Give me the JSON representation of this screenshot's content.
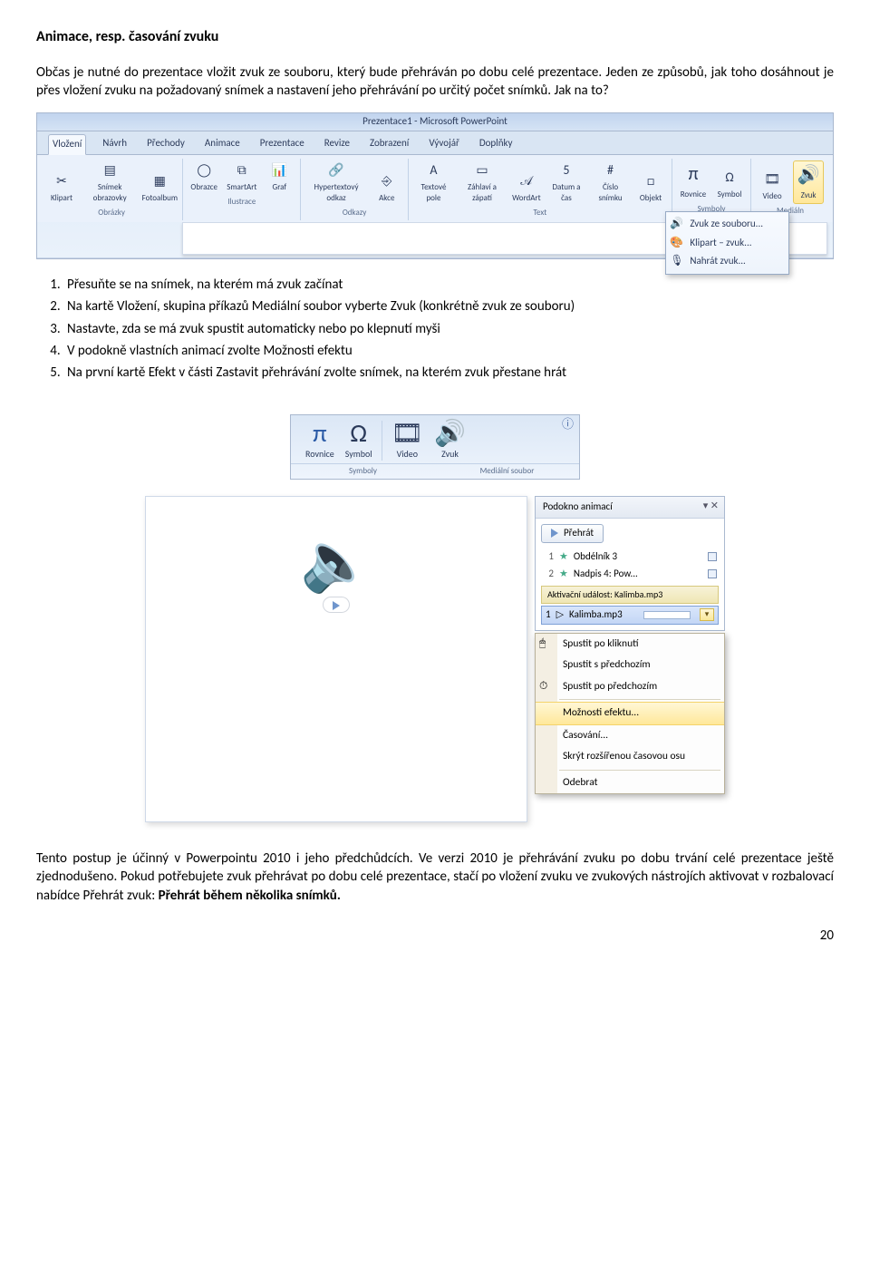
{
  "title": "Animace, resp. časování zvuku",
  "intro": "Občas je nutné do prezentace vložit zvuk ze souboru, který bude přehráván po dobu celé prezentace. Jeden ze způsobů, jak toho dosáhnout je přes vložení zvuku na požadovaný snímek a nastavení jeho přehrávání po určitý počet snímků. Jak na to?",
  "ribbon": {
    "title": "Prezentace1 - Microsoft PowerPoint",
    "tabs": [
      "Vložení",
      "Návrh",
      "Přechody",
      "Animace",
      "Prezentace",
      "Revize",
      "Zobrazení",
      "Vývojář",
      "Doplňky"
    ],
    "active_tab": "Vložení",
    "groups": {
      "obrazky": {
        "label": "Obrázky",
        "items": [
          {
            "icon": "✂",
            "label": "Klipart"
          },
          {
            "icon": "▤",
            "label": "Snímek obrazovky"
          },
          {
            "icon": "▦",
            "label": "Fotoalbum"
          }
        ]
      },
      "ilustrace": {
        "label": "Ilustrace",
        "items": [
          {
            "icon": "◯",
            "label": "Obrazce"
          },
          {
            "icon": "⧉",
            "label": "SmartArt"
          },
          {
            "icon": "📊",
            "label": "Graf"
          }
        ]
      },
      "odkazy": {
        "label": "Odkazy",
        "items": [
          {
            "icon": "🔗",
            "label": "Hypertextový odkaz"
          },
          {
            "icon": "⎆",
            "label": "Akce"
          }
        ]
      },
      "text": {
        "label": "Text",
        "items": [
          {
            "icon": "A",
            "label": "Textové pole"
          },
          {
            "icon": "▭",
            "label": "Záhlaví a zápatí"
          },
          {
            "icon": "𝒜",
            "label": "WordArt"
          },
          {
            "icon": "5",
            "label": "Datum a čas"
          },
          {
            "icon": "#",
            "label": "Číslo snímku"
          },
          {
            "icon": "□",
            "label": "Objekt"
          }
        ]
      },
      "symboly": {
        "label": "Symboly",
        "items": [
          {
            "icon": "π",
            "label": "Rovnice"
          },
          {
            "icon": "Ω",
            "label": "Symbol"
          }
        ]
      },
      "medialn": {
        "label": "Mediáln",
        "items": [
          {
            "icon": "🎞",
            "label": "Video"
          },
          {
            "icon": "🔊",
            "label": "Zvuk"
          }
        ]
      }
    },
    "menu": {
      "items": [
        {
          "icon": "🔊",
          "label": "Zvuk ze souboru...",
          "underline": "s"
        },
        {
          "icon": "🎨",
          "label": "Klipart – zvuk..."
        },
        {
          "icon": "🎙",
          "label": "Nahrát zvuk..."
        }
      ]
    }
  },
  "steps": [
    "Přesuňte se na snímek, na kterém má zvuk začínat",
    "Na kartě Vložení, skupina příkazů Mediální soubor vyberte Zvuk (konkrétně zvuk ze souboru)",
    "Nastavte, zda se má zvuk spustit automaticky nebo po klepnutí myši",
    "V podokně vlastních animací zvolte Možnosti efektu",
    "Na první kartě Efekt v části Zastavit přehrávání zvolte snímek, na kterém zvuk přestane hrát"
  ],
  "mini": {
    "help_icon": "ⓘ",
    "items": [
      {
        "icon": "π",
        "label": "Rovnice"
      },
      {
        "icon": "Ω",
        "label": "Symbol"
      },
      {
        "icon": "🎞",
        "label": "Video"
      },
      {
        "icon": "🔊",
        "label": "Zvuk"
      }
    ],
    "groups": [
      "Symboly",
      "Mediální soubor"
    ]
  },
  "pane": {
    "title": "Podokno animací",
    "play": "Přehrát",
    "items": [
      {
        "n": "1",
        "label": "Obdélník 3"
      },
      {
        "n": "2",
        "label": "Nadpis 4: Pow..."
      }
    ],
    "trigger": "Aktivační událost: Kalimba.mp3",
    "selected": {
      "n": "1",
      "label": "Kalimba.mp3"
    }
  },
  "ctx": {
    "items": [
      {
        "icon": "🖱",
        "label": "Spustit po kliknutí",
        "u": "k"
      },
      {
        "icon": "",
        "label": "Spustit s předchozím",
        "u": "h"
      },
      {
        "icon": "⏱",
        "label": "Spustit po předchozím",
        "u": "u"
      },
      {
        "icon": "",
        "label": "Možnosti efektu...",
        "u": "M",
        "hl": true
      },
      {
        "icon": "",
        "label": "Časování...",
        "u": "s"
      },
      {
        "icon": "",
        "label": "Skrýt rozšířenou časovou osu",
        "u": "k"
      },
      {
        "icon": "",
        "label": "Odebrat",
        "u": "O"
      }
    ]
  },
  "closing_pre": "Tento postup je účinný v Powerpointu 2010 i jeho předchůdcích. Ve verzi 2010 je přehrávání zvuku po dobu trvání celé prezentace ještě zjednodušeno. Pokud potřebujete zvuk přehrávat po dobu celé prezentace, stačí po vložení zvuku ve zvukových nástrojích aktivovat v rozbalovací nabídce Přehrát zvuk: ",
  "closing_bold": "Přehrát během několika snímků.",
  "page": "20"
}
